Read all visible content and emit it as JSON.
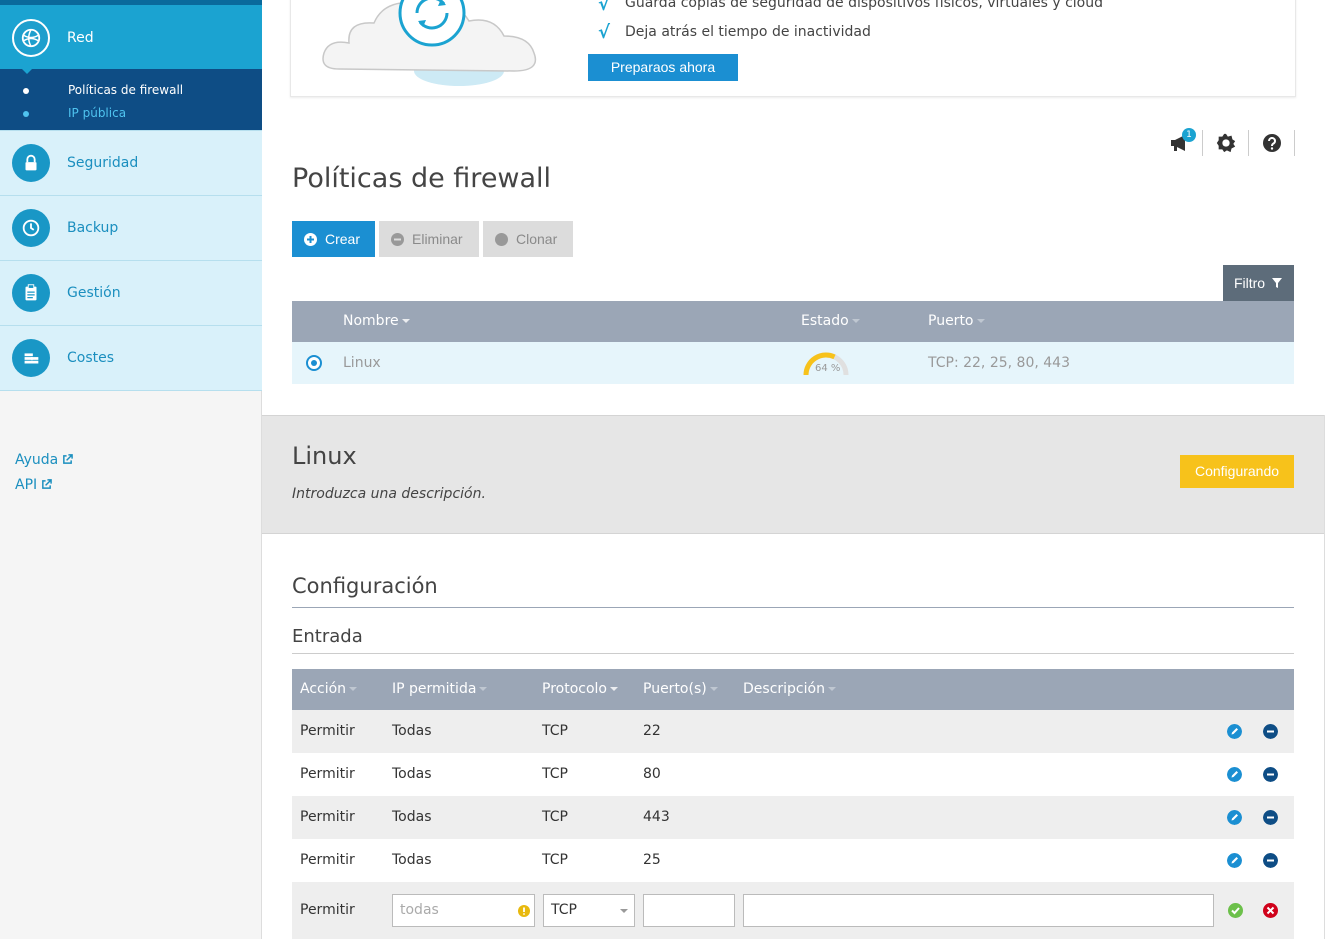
{
  "sidebar": {
    "active": {
      "label": "Red"
    },
    "subitems": [
      {
        "label": "Políticas de firewall",
        "color": "#ffffff"
      },
      {
        "label": "IP pública",
        "color": "#4fc3ef"
      }
    ],
    "items": [
      {
        "label": "Seguridad",
        "icon": "lock-icon"
      },
      {
        "label": "Backup",
        "icon": "clock-icon"
      },
      {
        "label": "Gestión",
        "icon": "clipboard-icon"
      },
      {
        "label": "Costes",
        "icon": "coins-icon"
      }
    ],
    "links": [
      {
        "label": "Ayuda"
      },
      {
        "label": "API"
      }
    ]
  },
  "promo": {
    "line1": "Guarda copias de seguridad de dispositivos físicos, virtuales y cloud",
    "line2": "Deja atrás el tiempo de inactividad",
    "button": "Preparaos ahora"
  },
  "toolbar": {
    "notifications_count": "1"
  },
  "page_title": "Políticas de firewall",
  "actions": {
    "create": "Crear",
    "delete": "Eliminar",
    "clone": "Clonar",
    "filter": "Filtro"
  },
  "list": {
    "headers": {
      "name": "Nombre",
      "status": "Estado",
      "port": "Puerto"
    },
    "rows": [
      {
        "name": "Linux",
        "status_percent": "64 %",
        "status_value": 0.64,
        "port": "TCP: 22, 25, 80, 443"
      }
    ]
  },
  "detail": {
    "title": "Linux",
    "description": "Introduzca una descripción.",
    "state_button": "Configurando"
  },
  "config": {
    "title": "Configuración",
    "inbound_title": "Entrada",
    "headers": {
      "action": "Acción",
      "ip": "IP permitida",
      "protocol": "Protocolo",
      "ports": "Puerto(s)",
      "description": "Descripción"
    },
    "rules": [
      {
        "action": "Permitir",
        "ip": "Todas",
        "protocol": "TCP",
        "port": "22",
        "description": ""
      },
      {
        "action": "Permitir",
        "ip": "Todas",
        "protocol": "TCP",
        "port": "80",
        "description": ""
      },
      {
        "action": "Permitir",
        "ip": "Todas",
        "protocol": "TCP",
        "port": "443",
        "description": ""
      },
      {
        "action": "Permitir",
        "ip": "Todas",
        "protocol": "TCP",
        "port": "25",
        "description": ""
      }
    ],
    "new_rule": {
      "action": "Permitir",
      "ip_placeholder": "todas",
      "protocol": "TCP",
      "port": "",
      "description": ""
    }
  },
  "colors": {
    "accent": "#1ba3d1",
    "primary_button": "#1b8fd2",
    "warning": "#f7c21b",
    "header_gray": "#9ba6b6"
  }
}
